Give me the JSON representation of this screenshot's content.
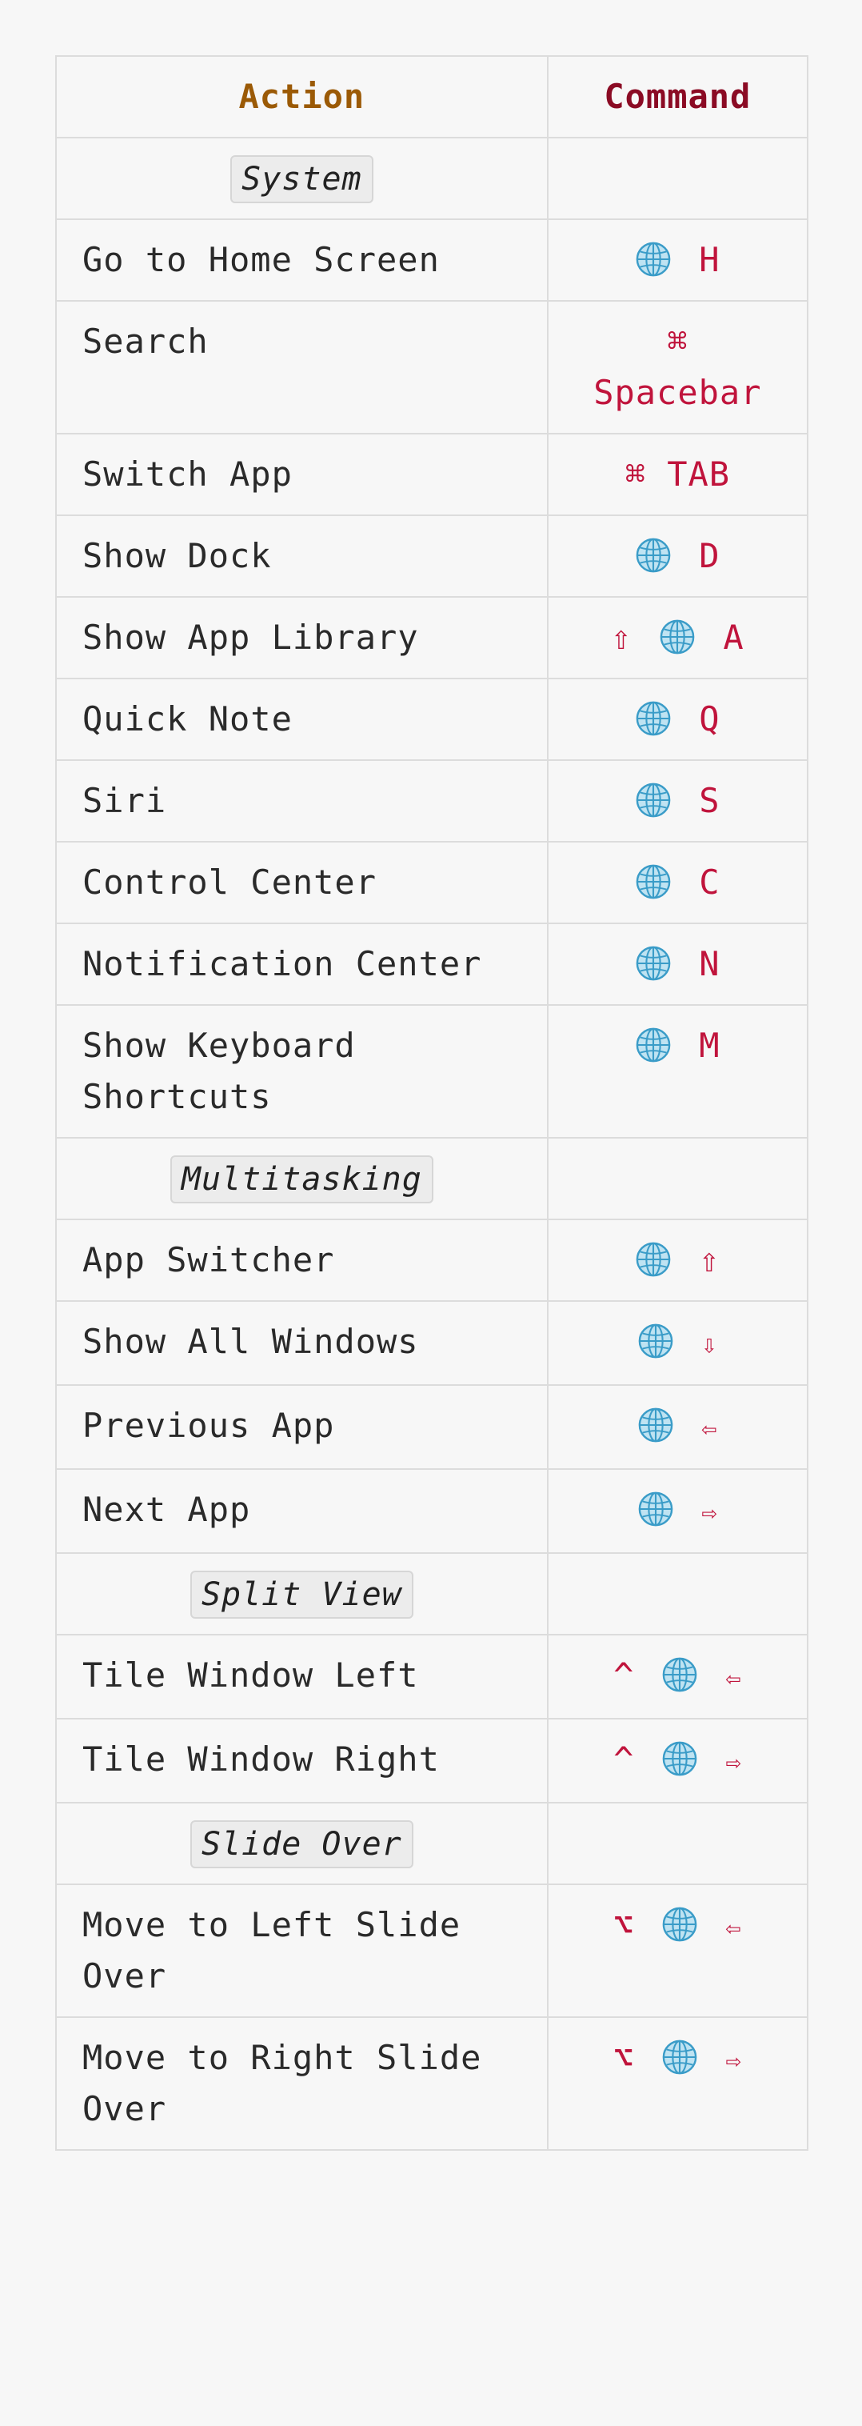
{
  "header": {
    "action": "Action",
    "command": "Command"
  },
  "rows": [
    {
      "type": "section",
      "label": "System"
    },
    {
      "type": "item",
      "action": "Go to Home Screen",
      "keys": [
        {
          "icon": "globe-icon"
        },
        {
          "t": "H"
        }
      ]
    },
    {
      "type": "item",
      "action": "Search",
      "keys": [
        {
          "t": "⌘"
        },
        {
          "t": "Spacebar"
        }
      ],
      "stack": true
    },
    {
      "type": "item",
      "action": "Switch App",
      "keys": [
        {
          "t": "⌘ TAB"
        }
      ]
    },
    {
      "type": "item",
      "action": "Show Dock",
      "keys": [
        {
          "icon": "globe-icon"
        },
        {
          "t": "D"
        }
      ]
    },
    {
      "type": "item",
      "action": "Show App Library",
      "keys": [
        {
          "t": "⇧"
        },
        {
          "icon": "globe-icon"
        },
        {
          "t": "A"
        }
      ]
    },
    {
      "type": "item",
      "action": "Quick Note",
      "keys": [
        {
          "icon": "globe-icon"
        },
        {
          "t": "Q"
        }
      ]
    },
    {
      "type": "item",
      "action": "Siri",
      "keys": [
        {
          "icon": "globe-icon"
        },
        {
          "t": "S"
        }
      ]
    },
    {
      "type": "item",
      "action": "Control Center",
      "keys": [
        {
          "icon": "globe-icon"
        },
        {
          "t": "C"
        }
      ]
    },
    {
      "type": "item",
      "action": "Notification Center",
      "keys": [
        {
          "icon": "globe-icon"
        },
        {
          "t": "N"
        }
      ]
    },
    {
      "type": "item",
      "action": "Show Keyboard Shortcuts",
      "keys": [
        {
          "icon": "globe-icon"
        },
        {
          "t": "M"
        }
      ]
    },
    {
      "type": "section",
      "label": "Multitasking"
    },
    {
      "type": "item",
      "action": "App Switcher",
      "keys": [
        {
          "icon": "globe-icon"
        },
        {
          "t": "⇧"
        }
      ]
    },
    {
      "type": "item",
      "action": "Show All Windows",
      "keys": [
        {
          "icon": "globe-icon"
        },
        {
          "t": "⇩"
        }
      ]
    },
    {
      "type": "item",
      "action": "Previous App",
      "keys": [
        {
          "icon": "globe-icon"
        },
        {
          "t": "⇦"
        }
      ]
    },
    {
      "type": "item",
      "action": "Next App",
      "keys": [
        {
          "icon": "globe-icon"
        },
        {
          "t": "⇨"
        }
      ]
    },
    {
      "type": "section",
      "label": "Split View"
    },
    {
      "type": "item",
      "action": "Tile Window Left",
      "keys": [
        {
          "t": "^"
        },
        {
          "icon": "globe-icon"
        },
        {
          "t": "⇦"
        }
      ]
    },
    {
      "type": "item",
      "action": "Tile Window Right",
      "keys": [
        {
          "t": "^"
        },
        {
          "icon": "globe-icon"
        },
        {
          "t": "⇨"
        }
      ]
    },
    {
      "type": "section",
      "label": "Slide Over"
    },
    {
      "type": "item",
      "action": "Move to Left Slide Over",
      "keys": [
        {
          "t": "⌥"
        },
        {
          "icon": "globe-icon"
        },
        {
          "t": "⇦"
        }
      ]
    },
    {
      "type": "item",
      "action": "Move to Right Slide Over",
      "keys": [
        {
          "t": "⌥"
        },
        {
          "icon": "globe-icon"
        },
        {
          "t": "⇨"
        }
      ]
    }
  ],
  "colors": {
    "action_header": "#9b5a06",
    "command_header": "#8b0b24",
    "key_text": "#c0143c",
    "body_text": "#2a2a2a",
    "border": "#dcdcdc"
  }
}
